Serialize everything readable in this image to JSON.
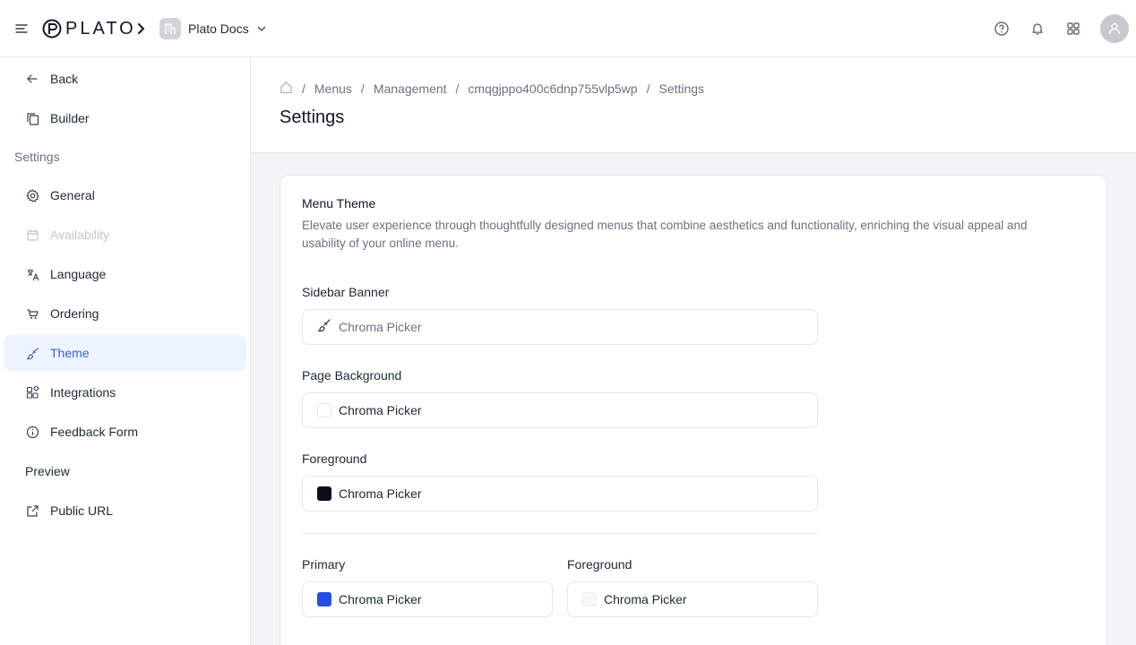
{
  "header": {
    "logo_text": "PLATO",
    "workspace": "Plato Docs"
  },
  "sidebar": {
    "back": "Back",
    "builder": "Builder",
    "section_settings": "Settings",
    "items": [
      {
        "label": "General"
      },
      {
        "label": "Availability"
      },
      {
        "label": "Language"
      },
      {
        "label": "Ordering"
      },
      {
        "label": "Theme"
      },
      {
        "label": "Integrations"
      },
      {
        "label": "Feedback Form"
      }
    ],
    "preview": "Preview",
    "public_url": "Public URL"
  },
  "breadcrumb": [
    "Menus",
    "Management",
    "cmqgjppo400c6dnp755vlp5wp",
    "Settings"
  ],
  "page_title": "Settings",
  "card": {
    "title": "Menu Theme",
    "description": "Elevate user experience through thoughtfully designed menus that combine aesthetics and functionality, enriching the visual appeal and usability of your online menu.",
    "fields": {
      "sidebar_banner": {
        "label": "Sidebar Banner",
        "value": "Chroma Picker"
      },
      "page_background": {
        "label": "Page Background",
        "value": "Chroma Picker",
        "color": "#ffffff"
      },
      "foreground": {
        "label": "Foreground",
        "value": "Chroma Picker",
        "color": "#0b0f1a"
      },
      "primary": {
        "label": "Primary",
        "value": "Chroma Picker",
        "color": "#2350e0"
      },
      "primary_foreground": {
        "label": "Foreground",
        "value": "Chroma Picker",
        "color": "#f7f7f8"
      }
    }
  },
  "colors": {
    "active_bg": "#eef4ff",
    "active_text": "#3b5fd0"
  }
}
